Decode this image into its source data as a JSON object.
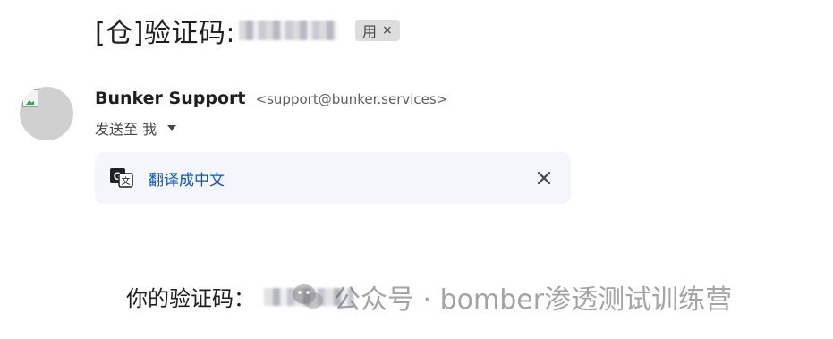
{
  "email": {
    "subject": "[仓]验证码:",
    "label_chip": {
      "label": "用",
      "close": "×"
    },
    "sender": {
      "name": "Bunker Support",
      "email": "<support@bunker.services>"
    },
    "recipient_line": "发送至 我",
    "translate_bar": {
      "link_label": "翻译成中文",
      "close_icon": "close-icon"
    },
    "body_text": "你的验证码："
  },
  "watermark": {
    "text": "公众号 · bomber渗透测试训练营"
  },
  "colors": {
    "link_blue": "#0b57d0",
    "translate_bar_bg": "#f4f6fc",
    "chip_bg": "#dddddd"
  }
}
